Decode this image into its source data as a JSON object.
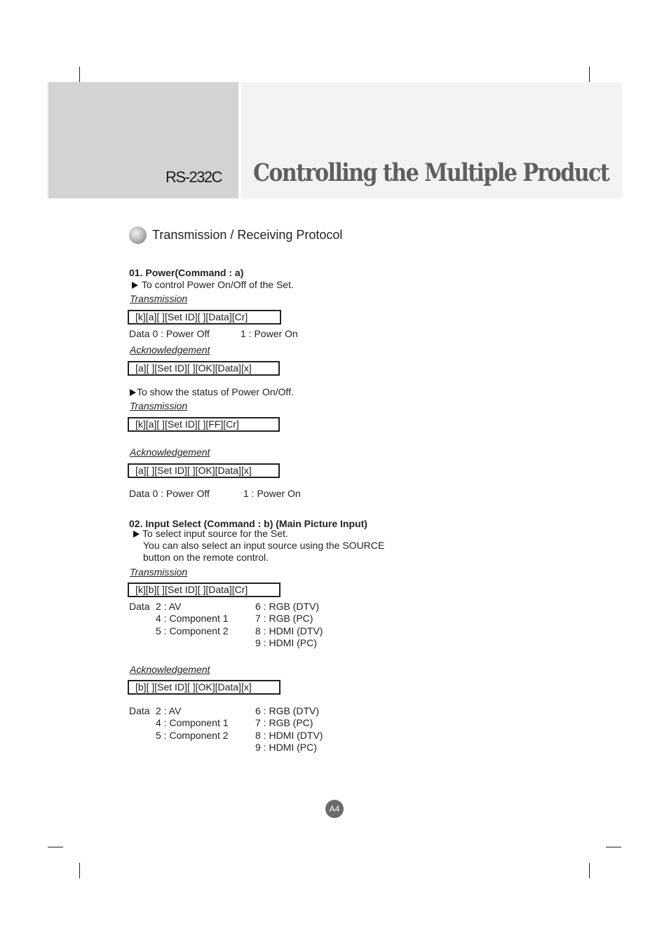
{
  "header": {
    "section_label": "RS-232C",
    "title": "Controlling the Multiple Product"
  },
  "section": {
    "title": "Transmission / Receiving Protocol",
    "icon": "grey-sphere-bullet-icon"
  },
  "commands": [
    {
      "heading": "01. Power(Command : a)",
      "blocks": [
        {
          "description": "To control Power On/Off of the Set.",
          "transmission_label": "Transmission",
          "transmission": "[k][a][ ][Set ID][ ][Data][Cr]",
          "data_line": {
            "left": "Data 0 : Power Off",
            "right": "1 : Power On"
          },
          "ack_label": "Acknowledgement",
          "ack": "[a][ ][Set ID][ ][OK][Data][x]"
        },
        {
          "description": "To show the status of Power On/Off.",
          "transmission_label": "Transmission",
          "transmission": "[k][a][ ][Set ID][ ][FF][Cr]",
          "ack_label": "Acknowledgement",
          "ack": "[a][ ][Set ID][ ][OK][Data][x]",
          "data_line": {
            "left": "Data 0 : Power Off",
            "right": "1 : Power On"
          }
        }
      ]
    },
    {
      "heading": "02. Input Select (Command : b) (Main Picture Input)",
      "description_lines": [
        "To select input source for the Set.",
        "You can also select an input source using the SOURCE",
        "button on the remote control."
      ],
      "transmission_label": "Transmission",
      "transmission": "[k][b][ ][Set ID][ ][Data][Cr]",
      "data_label": "Data",
      "data_values": {
        "left": [
          "2 : AV",
          "4 : Component 1",
          "5 : Component 2",
          ""
        ],
        "right": [
          "6 : RGB (DTV)",
          "7 : RGB (PC)",
          "8 : HDMI (DTV)",
          "9 : HDMI (PC)"
        ]
      },
      "ack_label": "Acknowledgement",
      "ack": "[b][ ][Set ID][ ][OK][Data][x]"
    }
  ],
  "footer": {
    "page_number": "A4"
  }
}
